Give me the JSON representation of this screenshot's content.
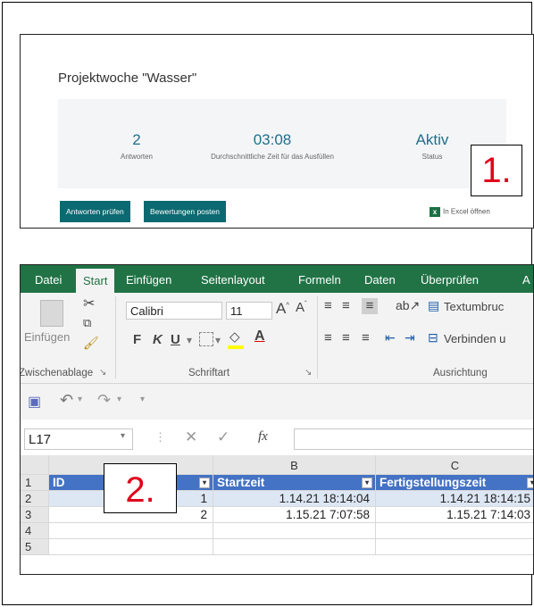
{
  "forms": {
    "title": "Projektwoche \"Wasser\"",
    "stats": [
      {
        "value": "2",
        "label": "Antworten"
      },
      {
        "value": "03:08",
        "label": "Durchschnittliche Zeit für das Ausfüllen"
      },
      {
        "value": "Aktiv",
        "label": "Status"
      }
    ],
    "buttons": {
      "review": "Antworten prüfen",
      "post": "Bewertungen posten"
    },
    "excel_link": "In Excel öffnen"
  },
  "callouts": {
    "one": "1.",
    "two": "2."
  },
  "excel": {
    "tabs": [
      "Datei",
      "Start",
      "Einfügen",
      "Seitenlayout",
      "Formeln",
      "Daten",
      "Überprüfen",
      "A"
    ],
    "active_tab": "Start",
    "ribbon": {
      "paste": "Einfügen",
      "font": "Calibri",
      "size": "11",
      "bold": "F",
      "italic": "K",
      "underline": "U",
      "wrap": "Textumbruc",
      "merge": "Verbinden u",
      "groups": {
        "clipboard": "Zwischenablage",
        "font": "Schriftart",
        "alignment": "Ausrichtung"
      }
    },
    "namebox": "L17",
    "fx": "fx",
    "columns": [
      "B",
      "C"
    ],
    "rows": [
      "1",
      "2",
      "3",
      "4",
      "5"
    ],
    "headers": [
      "ID",
      "Startzeit",
      "Fertigstellungszeit"
    ],
    "data": [
      [
        "1",
        "1.14.21 18:14:04",
        "1.14.21 18:14:15"
      ],
      [
        "2",
        "1.15.21 7:07:58",
        "1.15.21 7:14:03"
      ]
    ]
  },
  "colors": {
    "excel_green": "#217346",
    "table_header": "#4472c4",
    "forms_teal": "#0b6a71",
    "callout_red": "#e0001b"
  }
}
